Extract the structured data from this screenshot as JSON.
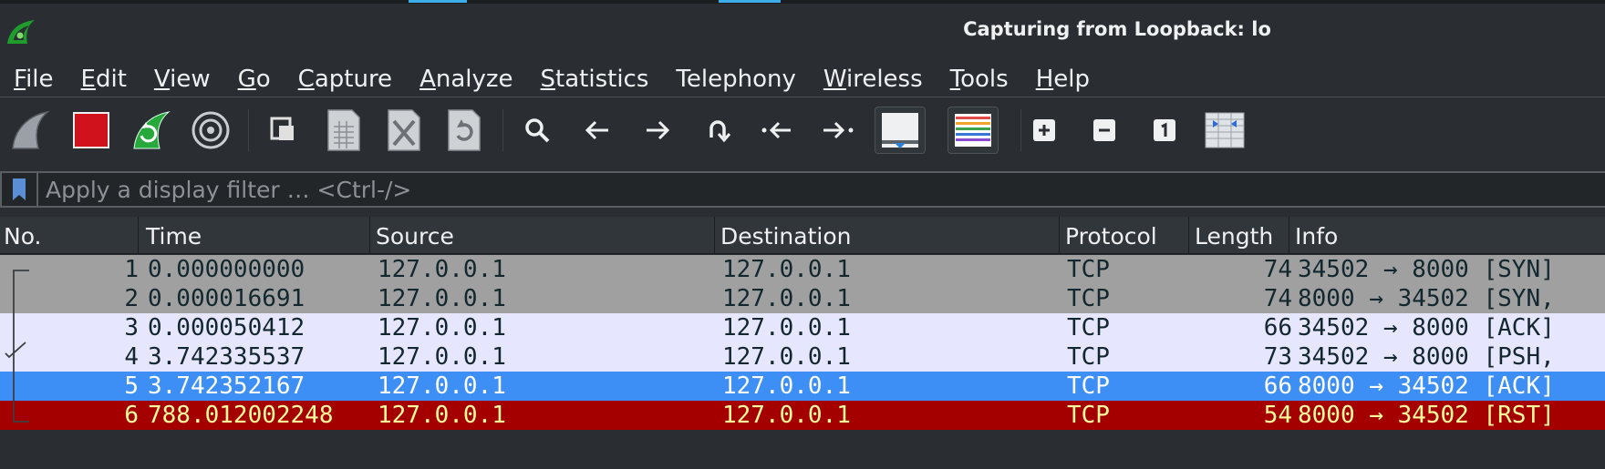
{
  "window": {
    "title": "Capturing from Loopback: lo"
  },
  "menubar": {
    "items": [
      {
        "mnemonic": "F",
        "rest": "ile"
      },
      {
        "mnemonic": "E",
        "rest": "dit"
      },
      {
        "mnemonic": "V",
        "rest": "iew"
      },
      {
        "mnemonic": "G",
        "rest": "o"
      },
      {
        "mnemonic": "C",
        "rest": "apture"
      },
      {
        "mnemonic": "A",
        "rest": "nalyze"
      },
      {
        "mnemonic": "S",
        "rest": "tatistics"
      },
      {
        "mnemonic": "",
        "rest": "Telephony"
      },
      {
        "mnemonic": "W",
        "rest": "ireless"
      },
      {
        "mnemonic": "T",
        "rest": "ools"
      },
      {
        "mnemonic": "H",
        "rest": "elp"
      }
    ]
  },
  "toolbar": {
    "icons": [
      "start-capture-icon",
      "stop-capture-icon",
      "restart-capture-icon",
      "capture-options-icon",
      "open-file-icon",
      "save-file-icon",
      "close-file-icon",
      "reload-file-icon",
      "find-packet-icon",
      "go-back-icon",
      "go-forward-icon",
      "go-to-packet-icon",
      "first-packet-icon",
      "last-packet-icon",
      "autoscroll-icon",
      "colorize-icon",
      "zoom-in-icon",
      "zoom-out-icon",
      "normal-size-icon",
      "resize-columns-icon"
    ]
  },
  "filter": {
    "placeholder": "Apply a display filter … <Ctrl-/>",
    "value": ""
  },
  "packet_list": {
    "columns": [
      "No.",
      "Time",
      "Source",
      "Destination",
      "Protocol",
      "Length",
      "Info"
    ],
    "rows": [
      {
        "no": "1",
        "time": "0.000000000",
        "source": "127.0.0.1",
        "destination": "127.0.0.1",
        "protocol": "TCP",
        "length": "74",
        "info": "34502 → 8000 [SYN]",
        "bg": "#a0a0a0",
        "fg": "#12272e"
      },
      {
        "no": "2",
        "time": "0.000016691",
        "source": "127.0.0.1",
        "destination": "127.0.0.1",
        "protocol": "TCP",
        "length": "74",
        "info": "8000 → 34502 [SYN,",
        "bg": "#a0a0a0",
        "fg": "#12272e"
      },
      {
        "no": "3",
        "time": "0.000050412",
        "source": "127.0.0.1",
        "destination": "127.0.0.1",
        "protocol": "TCP",
        "length": "66",
        "info": "34502 → 8000 [ACK]",
        "bg": "#e7e6ff",
        "fg": "#12272e"
      },
      {
        "no": "4",
        "time": "3.742335537",
        "source": "127.0.0.1",
        "destination": "127.0.0.1",
        "protocol": "TCP",
        "length": "73",
        "info": "34502 → 8000 [PSH,",
        "bg": "#e7e6ff",
        "fg": "#12272e"
      },
      {
        "no": "5",
        "time": "3.742352167",
        "source": "127.0.0.1",
        "destination": "127.0.0.1",
        "protocol": "TCP",
        "length": "66",
        "info": "8000 → 34502 [ACK]",
        "bg": "#3d8ff5",
        "fg": "#ffffff",
        "selected": true
      },
      {
        "no": "6",
        "time": "788.012002248",
        "source": "127.0.0.1",
        "destination": "127.0.0.1",
        "protocol": "TCP",
        "length": "54",
        "info": "8000 → 34502 [RST]",
        "bg": "#a40000",
        "fg": "#fffc9c"
      }
    ]
  },
  "colors": {
    "window_bg": "#2a2e32",
    "accent": "#3daee9"
  }
}
